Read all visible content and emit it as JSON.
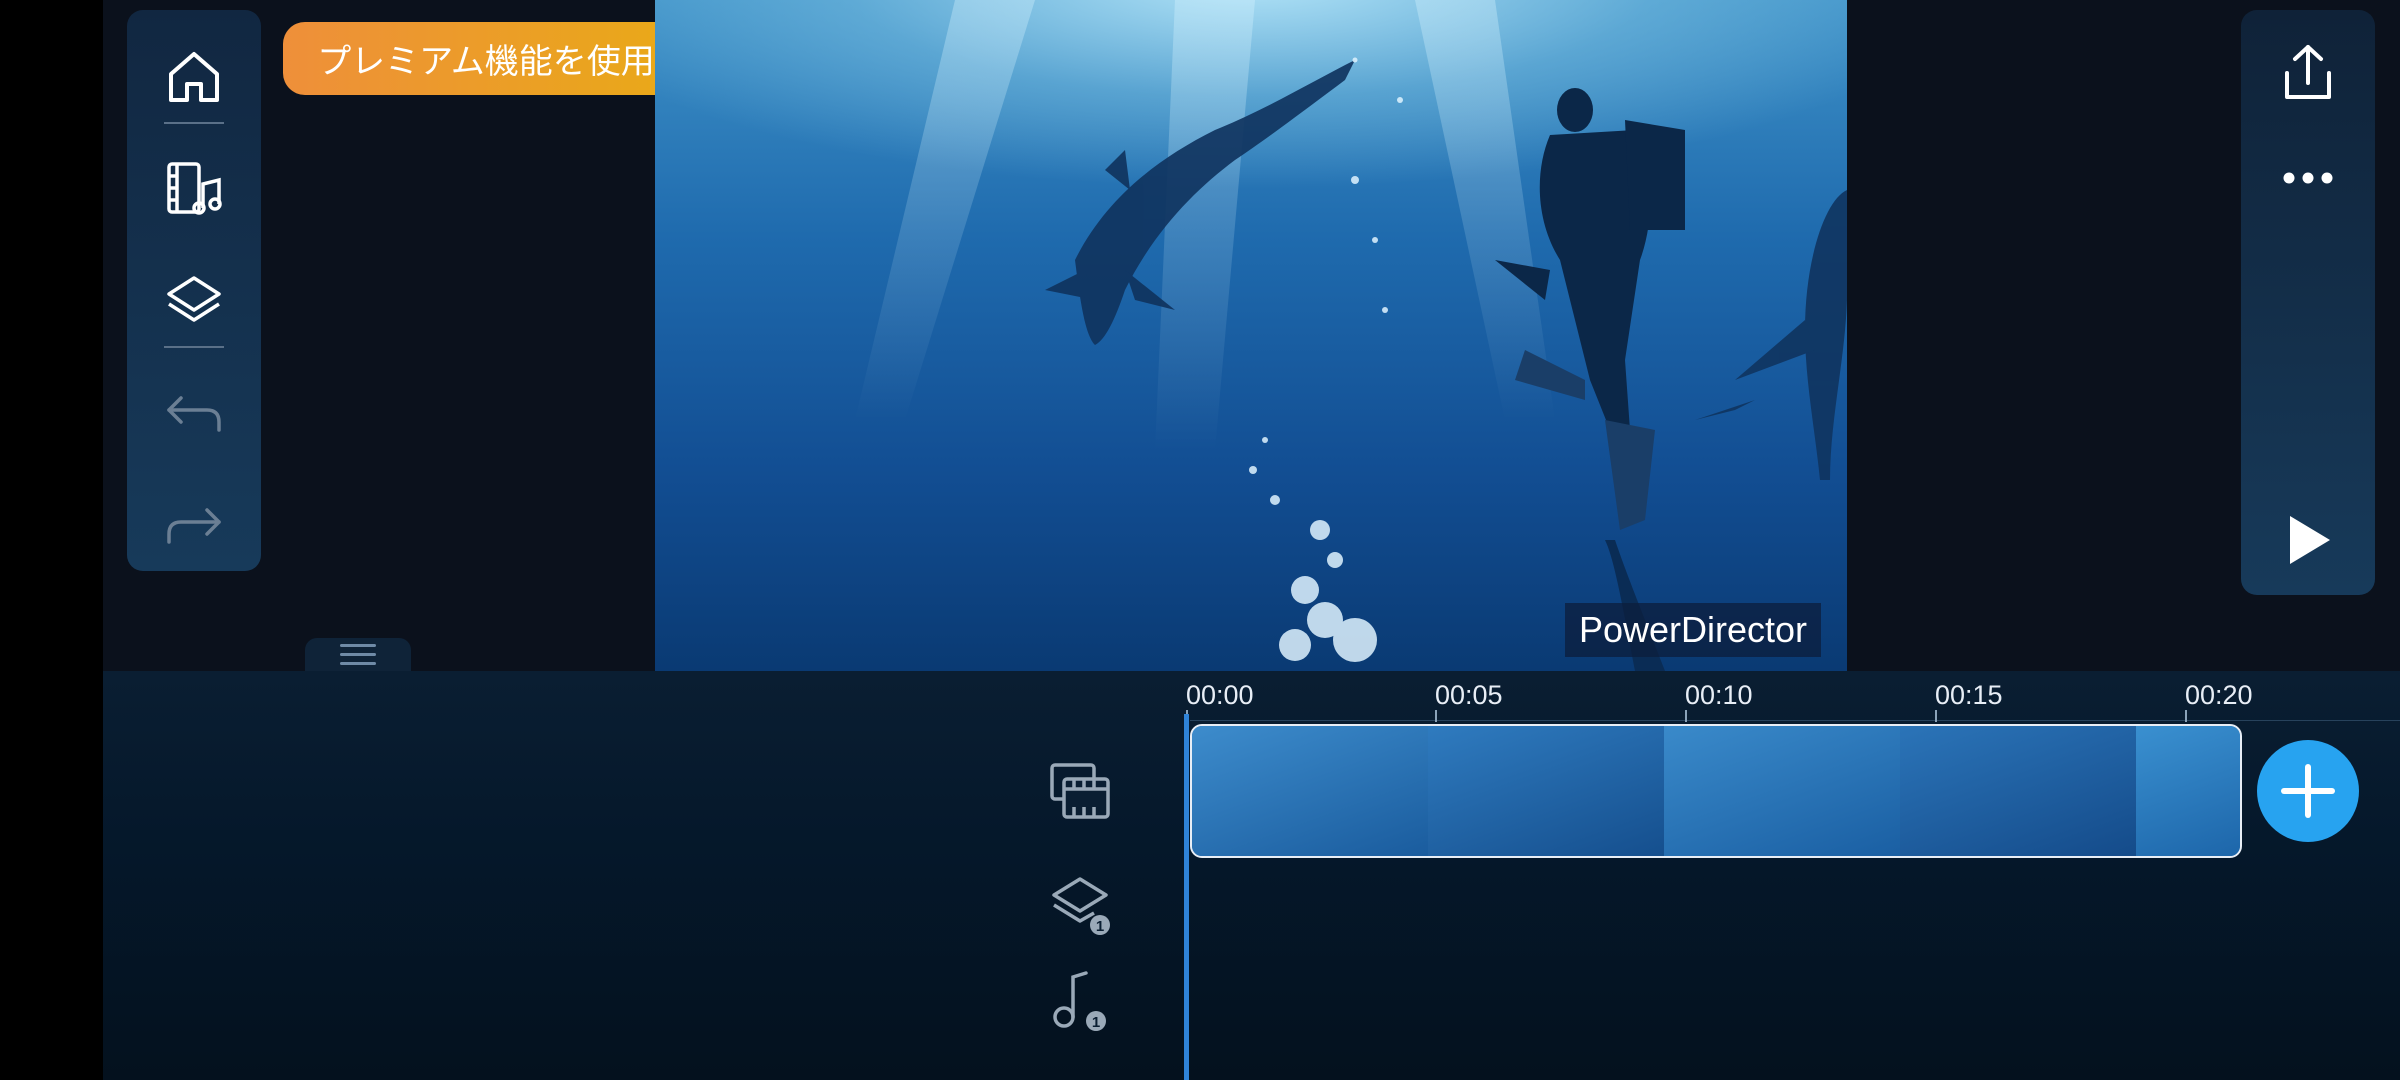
{
  "premium_label": "プレミアム機能を使用",
  "watermark": "PowerDirector",
  "left_toolbar": [
    "home",
    "media-music",
    "layers",
    "undo",
    "redo"
  ],
  "right_toolbar": [
    "export",
    "more-options",
    "play"
  ],
  "timeline": {
    "ruler": [
      "00:00",
      "00:05",
      "00:10",
      "00:15",
      "00:20"
    ],
    "overlay_track_count": "1",
    "audio_track_count": "1"
  },
  "colors": {
    "premium_start": "#ee8f3a",
    "premium_end": "#e9aa17",
    "playhead": "#2f83d8",
    "add_button": "#27a3f0"
  }
}
